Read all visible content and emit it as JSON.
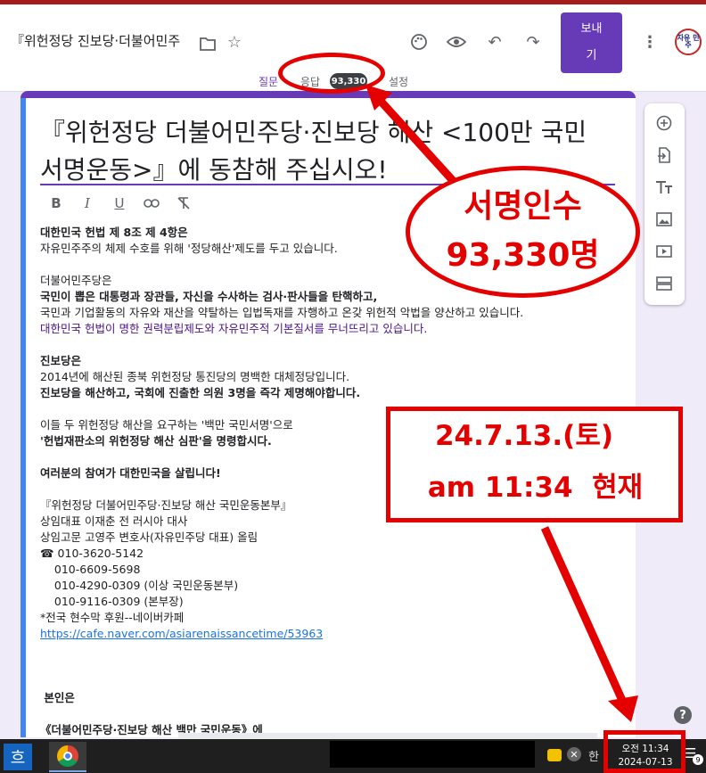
{
  "header": {
    "doc_title": "『위헌정당 진보당·더불어민주",
    "send_label_1": "보내",
    "send_label_2": "기",
    "avatar_text": "자유 민주",
    "tabs": [
      {
        "label": "질문"
      },
      {
        "label": "응답"
      },
      {
        "label": "설정"
      }
    ],
    "response_count": "93,330"
  },
  "form": {
    "title_line1": "『위헌정당 더불어민주당·진보당 해산 <100만 국민",
    "title_line2": "서명운동>』에 동참해 주십시오!",
    "format_buttons": [
      "B",
      "I",
      "U"
    ],
    "desc_lines": [
      "대한민국 헌법 제 8조 제 4항은",
      "자유민주주의 체제 수호를 위해 '정당해산'제도를 두고 있습니다.",
      "",
      "더불어민주당은",
      "국민이 뽑은 대통령과 장관들, 자신을 수사하는 검사·판사들을 탄핵하고,",
      "국민과 기업활동의 자유와 재산을 약탈하는 입법독재를 자행하고 온갖 위헌적 악법을 양산하고 있습니다.",
      "대한민국 헌법이 명한 권력분립제도와 자유민주적 기본질서를 무너뜨리고 있습니다.",
      "",
      "진보당은",
      "2014년에 해산된 종북 위헌정당 통진당의 명백한 대체정당입니다.",
      "진보당을 해산하고, 국회에 진출한 의원 3명을 즉각 제명해야합니다.",
      "",
      "이들 두 위헌정당 해산을 요구하는 '백만 국민서명'으로",
      "'헌법재판소의 위헌정당 해산 심판'을 명령합시다.",
      "",
      "여러분의 참여가 대한민국을 살립니다!",
      "",
      "『위헌정당 더불어민주당·진보당 해산 국민운동본부』",
      "상임대표 이재춘 전 러시아 대사",
      "상임고문 고영주 변호사(자유민주당 대표) 올림",
      "☎ 010-3620-5142",
      "    010-6609-5698",
      "    010-4290-0309 (이상 국민운동본부)",
      "    010-9116-0309 (본부장)",
      "*전국 현수막 후원--네이버카페"
    ],
    "link": "https://cafe.naver.com/asiarenaissancetime/53963",
    "tail_1": " 본인은",
    "tail_2": "《더불어민주당·진보당 해산 백만 국민운동》에"
  },
  "annotations": {
    "signatures_label": "서명인수",
    "signatures_value": "93,330명",
    "date_line": "24.7.13.(토)",
    "time_line": "am 11:34  현재"
  },
  "taskbar": {
    "ime": "한",
    "ime_badge": "흐",
    "clock_time": "오전 11:34",
    "clock_date": "2024-07-13",
    "notif_count": "9"
  },
  "colors": {
    "accent": "#673ab7",
    "annotation_red": "#e50000"
  }
}
